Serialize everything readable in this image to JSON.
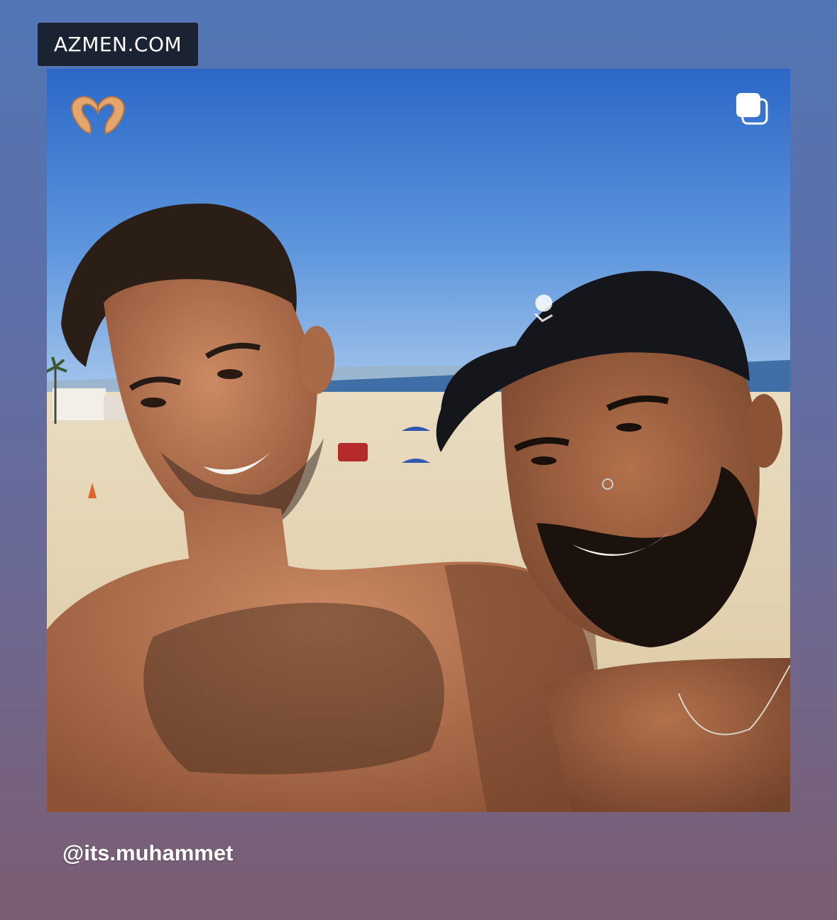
{
  "watermark": {
    "text": "AZMEN.COM"
  },
  "post": {
    "image_alt": "Two shirtless smiling men taking a selfie on a sunny beach; one wears a black cap",
    "caption_handle": "@its.muhammet",
    "sticker": "heart-hands-emoji",
    "multi_photo_indicator": "stacked-squares-icon"
  },
  "colors": {
    "sky_top": "#2f6fce",
    "sky_bottom": "#7fb2e8",
    "sand": "#e7d6b2",
    "skin": "#b77856",
    "cap": "#15171c"
  }
}
